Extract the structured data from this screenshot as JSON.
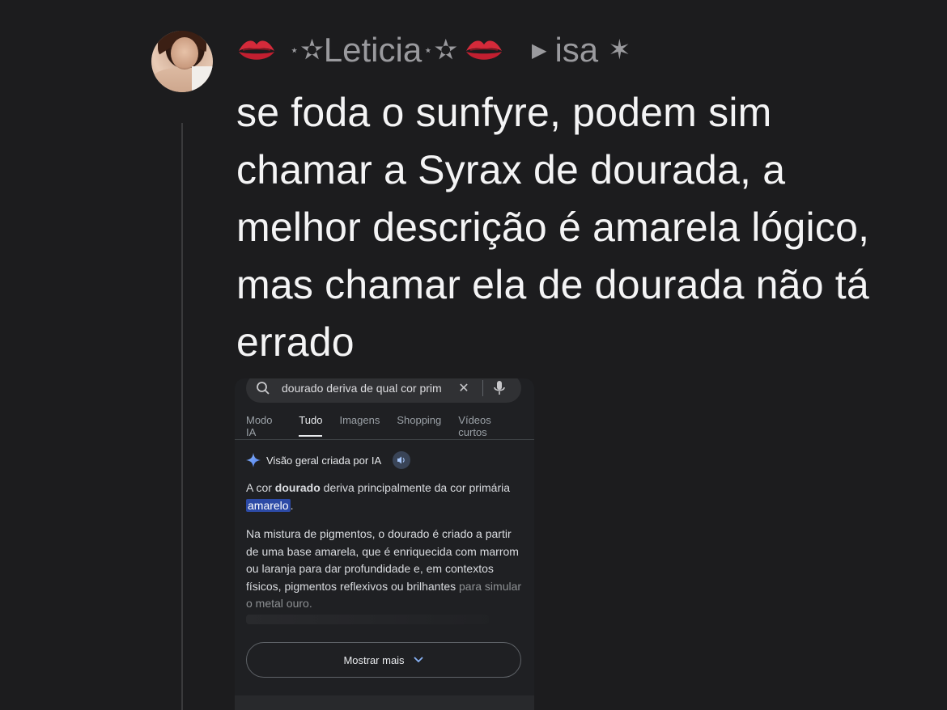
{
  "post": {
    "author_display": "Leticia",
    "reply_to": "isa",
    "text": "se foda o sunfyre, podem sim chamar a Syrax de dourada, a melhor descrição é amarela lógico, mas chamar ela de dourada não tá errado"
  },
  "embedded_search": {
    "query": "dourado deriva de qual cor prim",
    "tabs": [
      "Modo IA",
      "Tudo",
      "Imagens",
      "Shopping",
      "Vídeos curtos"
    ],
    "active_tab": "Tudo",
    "ai_overview_title": "Visão geral criada por IA",
    "answer_p1_pre": "A cor ",
    "answer_p1_bold": "dourado",
    "answer_p1_mid": " deriva principalmente da cor primária ",
    "answer_p1_highlight": "amarelo",
    "answer_p1_post": ".",
    "answer_p2_main": "Na mistura de pigmentos, o dourado é criado a partir de uma base amarela, que é enriquecida com marrom ou laranja para dar profundidade e, em contextos físicos, pigmentos reflexivos ou brilhantes",
    "answer_p2_fade": "para simular o metal ouro.",
    "show_more_label": "Mostrar mais"
  },
  "icons": {
    "header_emoji": "kiss-mark-icon",
    "search": "search-icon",
    "clear": "close-icon",
    "mic": "mic-icon",
    "sparkle": "sparkle-icon",
    "speaker": "speaker-icon",
    "chevron": "chevron-down-icon"
  },
  "colors": {
    "background": "#1c1c1e",
    "text_primary": "#f4f4f5",
    "text_muted": "#9a9a9e",
    "highlight": "#2c4aa6",
    "kiss_red": "#d42a3a"
  }
}
